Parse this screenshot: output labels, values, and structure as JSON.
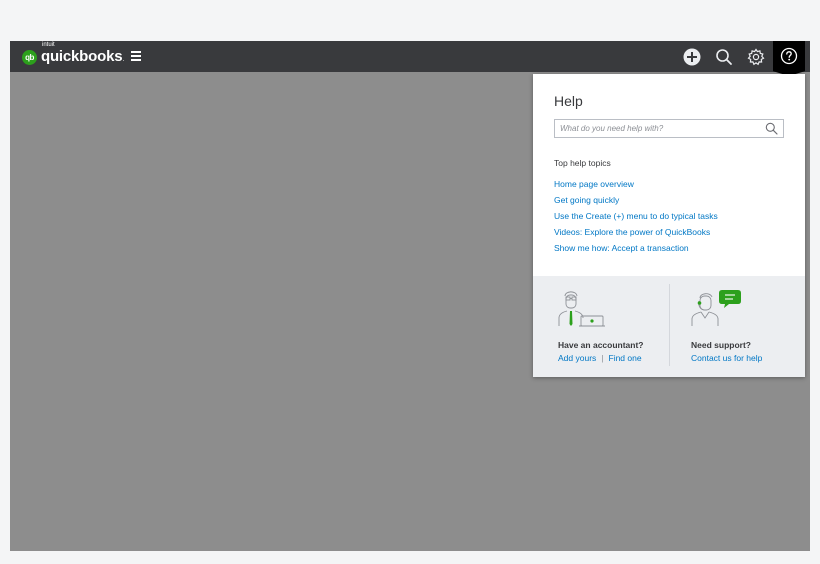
{
  "app": {
    "logo_badge": "qb",
    "logo_intuit": "intuit",
    "logo_text": "quickbooks",
    "logo_dot": ".",
    "brand_green": "#2ca01c",
    "topbar_color": "#393a3d"
  },
  "topbar": {
    "icons": [
      "hamburger-menu-icon",
      "create-plus-icon",
      "search-icon",
      "gear-icon",
      "help-question-icon"
    ]
  },
  "help": {
    "title": "Help",
    "search_placeholder": "What do you need help with?",
    "topics_heading": "Top help topics",
    "topics": [
      "Home page overview",
      "Get going quickly",
      "Use the Create (+) menu to do typical tasks",
      "Videos: Explore the power of QuickBooks",
      "Show me how: Accept a transaction"
    ],
    "link_color": "#0077c5",
    "accountant": {
      "title": "Have an accountant?",
      "add_link": "Add yours",
      "separator": "|",
      "find_link": "Find one"
    },
    "support": {
      "title": "Need support?",
      "link": "Contact us for help"
    }
  }
}
